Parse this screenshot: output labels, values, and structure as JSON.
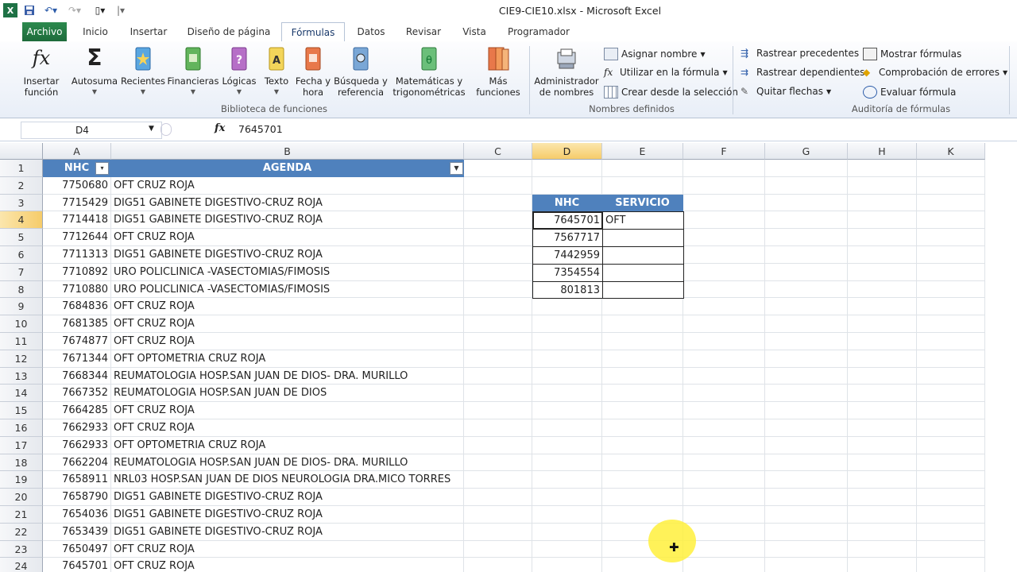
{
  "app": {
    "window_title": "CIE9-CIE10.xlsx - Microsoft Excel"
  },
  "ribbon": {
    "tabs": [
      "Archivo",
      "Inicio",
      "Insertar",
      "Diseño de página",
      "Fórmulas",
      "Datos",
      "Revisar",
      "Vista",
      "Programador"
    ],
    "active_tab": "Fórmulas",
    "function_library": {
      "insert_function": [
        "Insertar",
        "función"
      ],
      "autosum": "Autosuma",
      "recent": "Recientes",
      "financial": "Financieras",
      "logical": "Lógicas",
      "text": "Texto",
      "datetime": [
        "Fecha y",
        "hora"
      ],
      "lookup": [
        "Búsqueda y",
        "referencia"
      ],
      "math": [
        "Matemáticas y",
        "trigonométricas"
      ],
      "more": [
        "Más",
        "funciones"
      ],
      "group_label": "Biblioteca de funciones"
    },
    "defined_names": {
      "name_manager": [
        "Administrador",
        "de nombres"
      ],
      "assign_name": "Asignar nombre",
      "use_in_formula": "Utilizar en la fórmula",
      "create_from_selection": "Crear desde la selección",
      "group_label": "Nombres definidos"
    },
    "auditing": {
      "trace_precedents": "Rastrear precedentes",
      "trace_dependents": "Rastrear dependientes",
      "remove_arrows": "Quitar flechas",
      "show_formulas": "Mostrar fórmulas",
      "error_checking": "Comprobación de errores",
      "evaluate_formula": "Evaluar fórmula",
      "group_label": "Auditoría de fórmulas"
    },
    "colors": {
      "file_tab": "#217346",
      "accent": "#4f81bd"
    }
  },
  "formula_bar": {
    "name_box": "D4",
    "fx": "fx",
    "value": "7645701"
  },
  "columns": [
    "A",
    "B",
    "C",
    "D",
    "E",
    "F",
    "G",
    "H",
    "K"
  ],
  "selected_column": "D",
  "selected_row": "4",
  "table1": {
    "headers": [
      "NHC",
      "AGENDA"
    ],
    "rows": [
      [
        "7750680",
        "OFT CRUZ ROJA"
      ],
      [
        "7715429",
        "DIG51 GABINETE DIGESTIVO-CRUZ ROJA"
      ],
      [
        "7714418",
        "DIG51 GABINETE DIGESTIVO-CRUZ ROJA"
      ],
      [
        "7712644",
        "OFT CRUZ ROJA"
      ],
      [
        "7711313",
        "DIG51 GABINETE DIGESTIVO-CRUZ ROJA"
      ],
      [
        "7710892",
        "URO POLICLINICA -VASECTOMIAS/FIMOSIS"
      ],
      [
        "7710880",
        "URO POLICLINICA -VASECTOMIAS/FIMOSIS"
      ],
      [
        "7684836",
        "OFT CRUZ ROJA"
      ],
      [
        "7681385",
        "OFT CRUZ ROJA"
      ],
      [
        "7674877",
        "OFT CRUZ ROJA"
      ],
      [
        "7671344",
        "OFT OPTOMETRIA CRUZ ROJA"
      ],
      [
        "7668344",
        "REUMATOLOGIA HOSP.SAN JUAN DE DIOS- DRA. MURILLO"
      ],
      [
        "7667352",
        "REUMATOLOGIA HOSP.SAN JUAN DE DIOS"
      ],
      [
        "7664285",
        "OFT CRUZ ROJA"
      ],
      [
        "7662933",
        "OFT CRUZ ROJA"
      ],
      [
        "7662933",
        "OFT OPTOMETRIA CRUZ ROJA"
      ],
      [
        "7662204",
        "REUMATOLOGIA HOSP.SAN JUAN DE DIOS- DRA. MURILLO"
      ],
      [
        "7658911",
        "NRL03 HOSP.SAN JUAN DE DIOS NEUROLOGIA DRA.MICO TORRES"
      ],
      [
        "7658790",
        "DIG51 GABINETE DIGESTIVO-CRUZ ROJA"
      ],
      [
        "7654036",
        "DIG51 GABINETE DIGESTIVO-CRUZ ROJA"
      ],
      [
        "7653439",
        "DIG51 GABINETE DIGESTIVO-CRUZ ROJA"
      ],
      [
        "7650497",
        "OFT CRUZ ROJA"
      ],
      [
        "7645701",
        "OFT CRUZ ROJA"
      ]
    ]
  },
  "table2": {
    "headers": [
      "NHC",
      "SERVICIO"
    ],
    "rows": [
      [
        "7645701",
        "OFT"
      ],
      [
        "7567717",
        ""
      ],
      [
        "7442959",
        ""
      ],
      [
        "7354554",
        ""
      ],
      [
        "801813",
        ""
      ]
    ]
  },
  "row_numbers": [
    "1",
    "2",
    "3",
    "4",
    "5",
    "6",
    "7",
    "8",
    "9",
    "10",
    "11",
    "12",
    "13",
    "14",
    "15",
    "16",
    "17",
    "18",
    "19",
    "20",
    "21",
    "22",
    "23",
    "24"
  ]
}
